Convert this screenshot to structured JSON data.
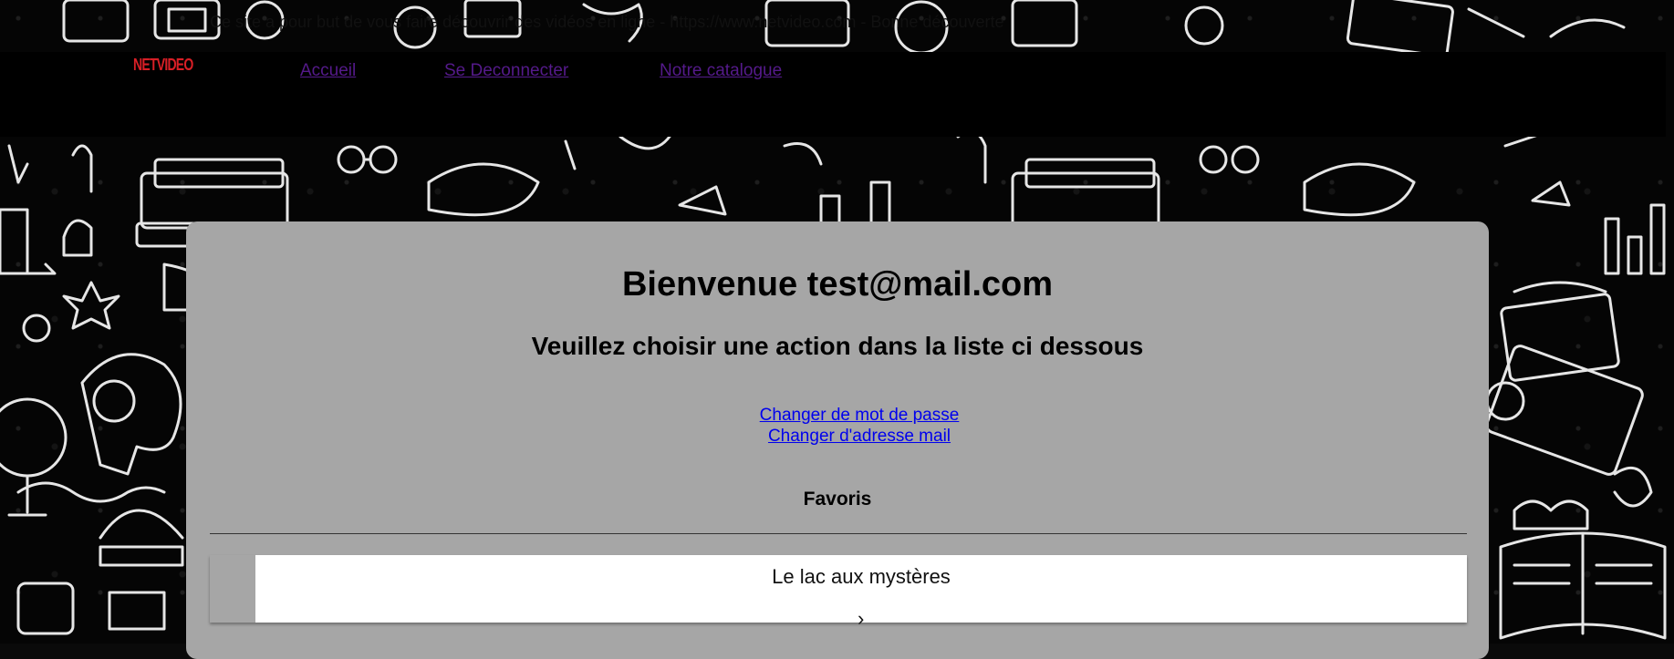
{
  "top_strip": {
    "text": "Ce site a pour but de vous faire découvrir des vidéos en ligne - https://www.netvideo.com - Bonne découverte"
  },
  "navbar": {
    "logo": "NETVIDEO",
    "links": [
      "Accueil",
      "Se Deconnecter",
      "Notre catalogue"
    ]
  },
  "main": {
    "welcome": "Bienvenue test@mail.com",
    "instruction": "Veuillez choisir une action dans la liste ci dessous",
    "actions": [
      "Changer de mot de passe",
      "Changer d'adresse mail"
    ],
    "favorites_heading": "Favoris",
    "favorites": [
      {
        "title": "Le lac aux mystères",
        "chevron": "›"
      }
    ]
  },
  "colors": {
    "logo": "#d81f26",
    "panel": "#a6a6a6",
    "navbar": "#000000",
    "link": "#0000ee",
    "visited_link": "#551a8b"
  },
  "icons": [
    "chevron-right-icon"
  ]
}
